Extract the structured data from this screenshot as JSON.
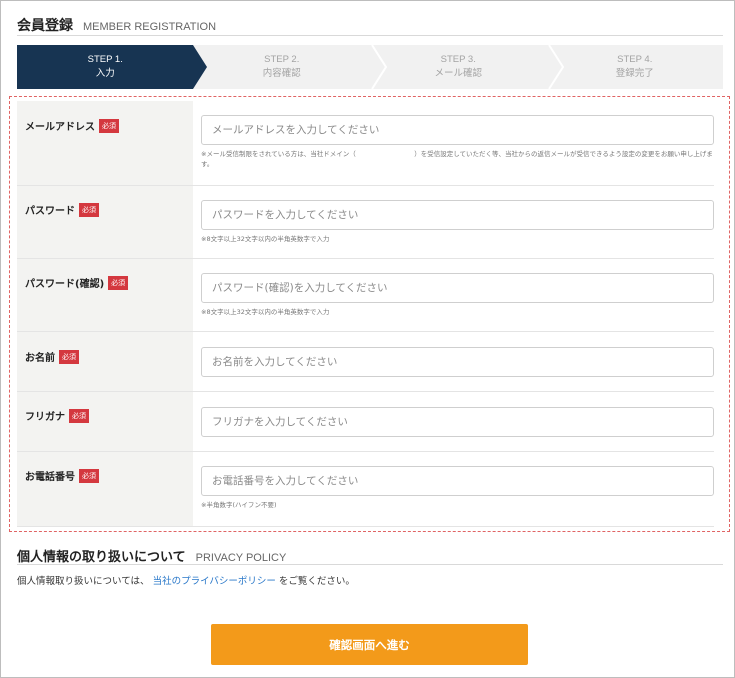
{
  "registration": {
    "title_jp": "会員登録",
    "title_en": "MEMBER REGISTRATION"
  },
  "steps": [
    {
      "num": "STEP 1.",
      "label": "入力",
      "active": true
    },
    {
      "num": "STEP 2.",
      "label": "内容確認",
      "active": false
    },
    {
      "num": "STEP 3.",
      "label": "メール確認",
      "active": false
    },
    {
      "num": "STEP 4.",
      "label": "登録完了",
      "active": false
    }
  ],
  "colors": {
    "step_active": "#173452",
    "required": "#d4383f",
    "dashed_border": "#e06464",
    "submit": "#f39a1a",
    "link": "#2a78c9"
  },
  "required_label": "必須",
  "fields": {
    "email": {
      "label": "メールアドレス",
      "placeholder": "メールアドレスを入力してください",
      "note": "※メール受信制限をされている方は、当社ドメイン（　　　　　　　　　）を受信設定していただく等、当社からの返信メールが受信できるよう設定の変更をお願い申し上げます。"
    },
    "password": {
      "label": "パスワード",
      "placeholder": "パスワードを入力してください",
      "note": "※8文字以上32文字以内の半角英数字で入力"
    },
    "password_confirm": {
      "label": "パスワード(確認)",
      "placeholder": "パスワード(確認)を入力してください",
      "note": "※8文字以上32文字以内の半角英数字で入力"
    },
    "name": {
      "label": "お名前",
      "placeholder": "お名前を入力してください"
    },
    "furigana": {
      "label": "フリガナ",
      "placeholder": "フリガナを入力してください"
    },
    "phone": {
      "label": "お電話番号",
      "placeholder": "お電話番号を入力してください",
      "note": "※半角数字(ハイフン不要)"
    }
  },
  "privacy": {
    "title_jp": "個人情報の取り扱いについて",
    "title_en": "PRIVACY POLICY",
    "text_before": "個人情報取り扱いについては、",
    "link_text": "当社のプライバシーポリシー",
    "text_after": "をご覧ください。"
  },
  "submit_label": "確認画面へ進む"
}
